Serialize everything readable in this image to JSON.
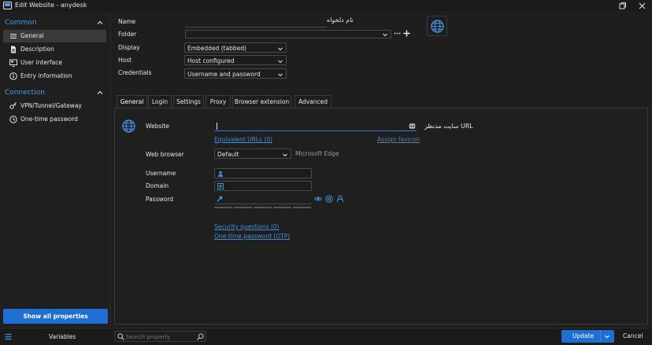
{
  "window": {
    "title": "Edit Website - anydesk"
  },
  "sidebar": {
    "sections": [
      {
        "label": "Common",
        "items": [
          {
            "label": "General",
            "icon": "list-icon",
            "active": true
          },
          {
            "label": "Description",
            "icon": "document-icon"
          },
          {
            "label": "User interface",
            "icon": "monitor-icon"
          },
          {
            "label": "Entry information",
            "icon": "info-icon"
          }
        ]
      },
      {
        "label": "Connection",
        "items": [
          {
            "label": "VPN/Tunnel/Gateway",
            "icon": "network-icon"
          },
          {
            "label": "One-time password",
            "icon": "clock-icon"
          }
        ]
      }
    ],
    "show_all_label": "Show all properties"
  },
  "form": {
    "name_label": "Name",
    "name_value": "نام دلخواه",
    "folder_label": "Folder",
    "folder_value": "",
    "display_label": "Display",
    "display_value": "Embedded (tabbed)",
    "host_label": "Host",
    "host_value": "Host configured",
    "credentials_label": "Credentials",
    "credentials_value": "Username and password"
  },
  "tabs": [
    {
      "label": "General",
      "active": true
    },
    {
      "label": "Login"
    },
    {
      "label": "Settings"
    },
    {
      "label": "Proxy"
    },
    {
      "label": "Browser extension"
    },
    {
      "label": "Advanced"
    }
  ],
  "general": {
    "website_label": "Website",
    "website_value": "",
    "url_hint": "سایت مدنظر URL",
    "equivalent_urls": "Equivalent URLs (0)",
    "assign_favicon": "Assign favicon",
    "web_browser_label": "Web browser",
    "web_browser_value": "Default",
    "web_browser_hint": "Microsoft Edge",
    "username_label": "Username",
    "username_value": "",
    "domain_label": "Domain",
    "domain_value": "",
    "password_label": "Password",
    "password_value": "",
    "security_questions": "Security questions (0)",
    "otp_link": "One-time password (OTP)"
  },
  "bottom": {
    "variables_label": "Variables",
    "search_placeholder": "Search property",
    "update_label": "Update",
    "cancel_label": "Cancel"
  },
  "colors": {
    "accent": "#1f6fd3",
    "link": "#3f8fdc",
    "section": "#4c9be8",
    "background": "#1e1e1e"
  }
}
